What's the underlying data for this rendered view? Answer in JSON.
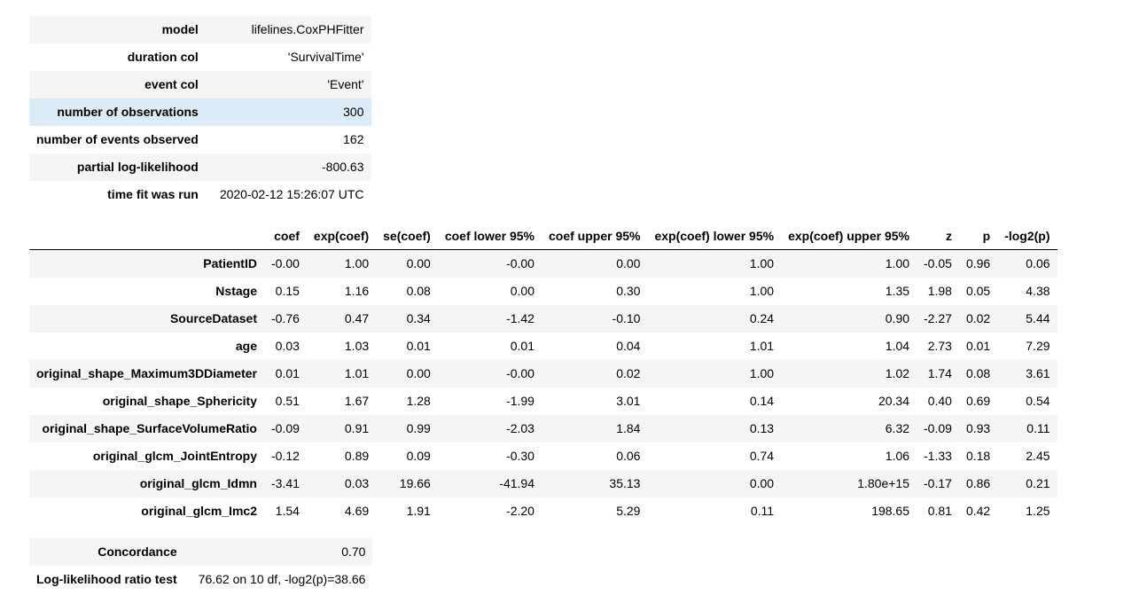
{
  "summary": [
    {
      "label": "model",
      "value": "lifelines.CoxPHFitter"
    },
    {
      "label": "duration col",
      "value": "'SurvivalTime'"
    },
    {
      "label": "event col",
      "value": "'Event'"
    },
    {
      "label": "number of observations",
      "value": "300"
    },
    {
      "label": "number of events observed",
      "value": "162"
    },
    {
      "label": "partial log-likelihood",
      "value": "-800.63"
    },
    {
      "label": "time fit was run",
      "value": "2020-02-12 15:26:07 UTC"
    }
  ],
  "coef_table": {
    "headers": [
      "coef",
      "exp(coef)",
      "se(coef)",
      "coef lower 95%",
      "coef upper 95%",
      "exp(coef) lower 95%",
      "exp(coef) upper 95%",
      "z",
      "p",
      "-log2(p)"
    ],
    "rows": [
      {
        "name": "PatientID",
        "values": [
          "-0.00",
          "1.00",
          "0.00",
          "-0.00",
          "0.00",
          "1.00",
          "1.00",
          "-0.05",
          "0.96",
          "0.06"
        ]
      },
      {
        "name": "Nstage",
        "values": [
          "0.15",
          "1.16",
          "0.08",
          "0.00",
          "0.30",
          "1.00",
          "1.35",
          "1.98",
          "0.05",
          "4.38"
        ]
      },
      {
        "name": "SourceDataset",
        "values": [
          "-0.76",
          "0.47",
          "0.34",
          "-1.42",
          "-0.10",
          "0.24",
          "0.90",
          "-2.27",
          "0.02",
          "5.44"
        ]
      },
      {
        "name": "age",
        "values": [
          "0.03",
          "1.03",
          "0.01",
          "0.01",
          "0.04",
          "1.01",
          "1.04",
          "2.73",
          "0.01",
          "7.29"
        ]
      },
      {
        "name": "original_shape_Maximum3DDiameter",
        "values": [
          "0.01",
          "1.01",
          "0.00",
          "-0.00",
          "0.02",
          "1.00",
          "1.02",
          "1.74",
          "0.08",
          "3.61"
        ]
      },
      {
        "name": "original_shape_Sphericity",
        "values": [
          "0.51",
          "1.67",
          "1.28",
          "-1.99",
          "3.01",
          "0.14",
          "20.34",
          "0.40",
          "0.69",
          "0.54"
        ]
      },
      {
        "name": "original_shape_SurfaceVolumeRatio",
        "values": [
          "-0.09",
          "0.91",
          "0.99",
          "-2.03",
          "1.84",
          "0.13",
          "6.32",
          "-0.09",
          "0.93",
          "0.11"
        ]
      },
      {
        "name": "original_glcm_JointEntropy",
        "values": [
          "-0.12",
          "0.89",
          "0.09",
          "-0.30",
          "0.06",
          "0.74",
          "1.06",
          "-1.33",
          "0.18",
          "2.45"
        ]
      },
      {
        "name": "original_glcm_Idmn",
        "values": [
          "-3.41",
          "0.03",
          "19.66",
          "-41.94",
          "35.13",
          "0.00",
          "1.80e+15",
          "-0.17",
          "0.86",
          "0.21"
        ]
      },
      {
        "name": "original_glcm_Imc2",
        "values": [
          "1.54",
          "4.69",
          "1.91",
          "-2.20",
          "5.29",
          "0.11",
          "198.65",
          "0.81",
          "0.42",
          "1.25"
        ]
      }
    ]
  },
  "bottom": [
    {
      "label": "Concordance",
      "value": "0.70"
    },
    {
      "label": "Log-likelihood ratio test",
      "value": "76.62 on 10 df, -log2(p)=38.66"
    }
  ],
  "colors": {
    "stripe": "#f5f5f5",
    "highlight": "#dcebf8"
  }
}
